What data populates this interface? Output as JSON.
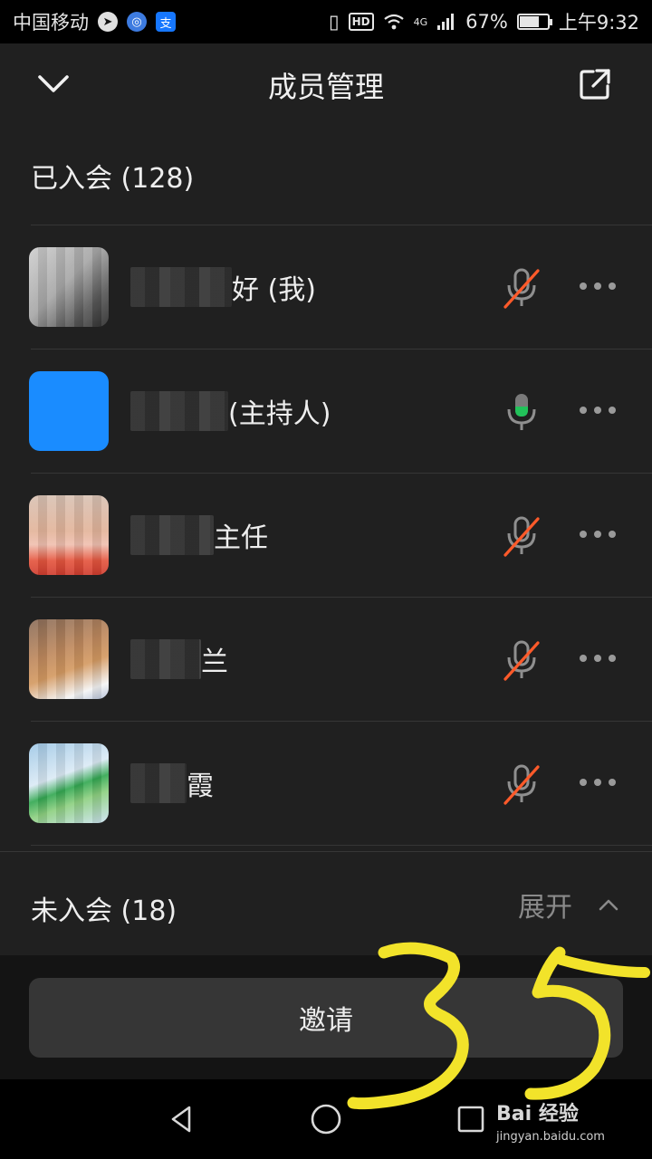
{
  "status_bar": {
    "carrier": "中国移动",
    "network": "4G",
    "battery": "67%",
    "battery_level": 0.67,
    "time": "上午9:32",
    "hd": "HD",
    "app_icons": [
      "paper-plane-icon",
      "browser-icon",
      "alipay-icon"
    ]
  },
  "header": {
    "title": "成员管理",
    "left_icon": "chevron-down-icon",
    "right_icon": "external-link-icon"
  },
  "joined": {
    "title": "已入会 (128)",
    "members": [
      {
        "name": "好 (我)",
        "mic": "muted"
      },
      {
        "name": " (主持人)",
        "mic": "active"
      },
      {
        "name": "主任",
        "mic": "muted"
      },
      {
        "name": "兰",
        "mic": "muted"
      },
      {
        "name": "霞",
        "mic": "muted"
      }
    ]
  },
  "not_joined": {
    "title": "未入会 (18)",
    "expand_label": "展开"
  },
  "invite_label": "邀请",
  "colors": {
    "background": "#202020",
    "muted_slash": "#ff5a2a",
    "mic_active": "#22c25a",
    "avatar_blue": "#1a8cff"
  },
  "annotation": "35",
  "watermark": {
    "brand": "Bai 经验",
    "url": "jingyan.baidu.com"
  }
}
